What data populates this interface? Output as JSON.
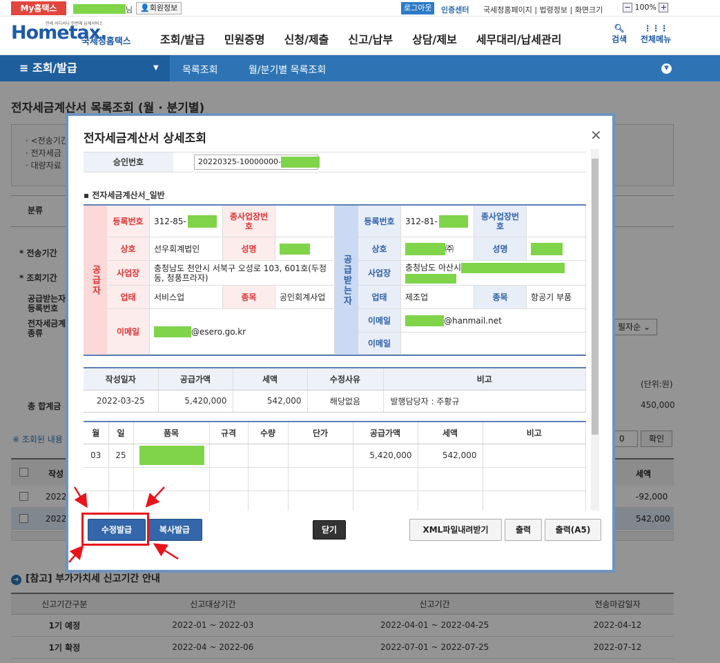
{
  "topbar": {
    "my_hometax": "My홈택스",
    "name_suffix": "님",
    "member_info": "회원정보",
    "logout": "로그아웃",
    "certificate": "인증센터",
    "links": "국세청홈페이지 | 법령정보 | 화면크기",
    "zoom": "100%",
    "zoom_minus": "−",
    "zoom_plus": "+"
  },
  "header": {
    "logo": "Hometax.",
    "logo_sub": "국세청홈택스",
    "logo_tag": "언제 어디서나 한번에 납세서비스",
    "gnb": [
      "조회/발급",
      "민원증명",
      "신청/제출",
      "신고/납부",
      "상담/제보",
      "세무대리/납세관리"
    ],
    "search": "검색",
    "all_menu": "전체메뉴"
  },
  "nav": {
    "main": "조회/발급",
    "crumb1": "목록조회",
    "crumb2": "월/분기별 목록조회"
  },
  "page": {
    "title": "전자세금계산서 목록조회 (월 · 분기별)",
    "info1": "· <전송기간",
    "info2": "· 전자세금",
    "info3": "· 대량자료",
    "cat": "분류",
    "transmit": "* 전송기간",
    "lookup": "* 조회기간",
    "receiver1": "공급받는자",
    "receiver2": "등록번호",
    "type1": "전자세금계",
    "type2": "종류",
    "sort": "필자순",
    "unit": "(단위:원)",
    "total": "총 합계금",
    "total_val": "450,000",
    "note": "※ 조회된 내용",
    "sel0": "0",
    "confirm": "확인",
    "col_written": "작성",
    "col_tax": "세액",
    "row1_date": "2022-",
    "row1_tax": "-92,000",
    "row2_date": "2022-",
    "row2_tax": "542,000"
  },
  "ref": {
    "title": "[참고] 부가가치세 신고기간 안내",
    "headers": [
      "신고기간구분",
      "신고대상기간",
      "신고기간",
      "전송마감일자"
    ],
    "rows": [
      [
        "1기 예정",
        "2022-01 ~ 2022-03",
        "2022-04-01 ~ 2022-04-25",
        "2022-04-12"
      ],
      [
        "1기 확정",
        "2022-04 ~ 2022-06",
        "2022-07-01 ~ 2022-07-25",
        "2022-07-12"
      ]
    ]
  },
  "modal": {
    "title": "전자세금계산서 상세조회",
    "approval_label": "승인번호",
    "approval_value": "20220325-10000000-",
    "section": "전자세금계산서_일반",
    "supplier": {
      "head": "공급자",
      "reg_label": "등록번호",
      "reg_value": "312-85-",
      "sub_label": "종사업장번호",
      "name_label": "상호",
      "name_value": "선우회계법인",
      "rep_label": "성명",
      "addr_label": "사업장",
      "addr_value": "충청남도 천안시 서북구 오성로 103, 601호(두정동, 청풍프라자)",
      "biz_label": "업태",
      "biz_value": "서비스업",
      "item_label": "종목",
      "item_value": "공인회계사업",
      "email_label": "이메일",
      "email_value": "@esero.go.kr"
    },
    "buyer": {
      "head": "공급받는자",
      "reg_label": "등록번호",
      "reg_value": "312-81-",
      "sub_label": "종사업장번호",
      "name_label": "상호",
      "name_suffix": "㈜",
      "rep_label": "성명",
      "addr_label": "사업장",
      "addr_value": "충청남도 아산시",
      "biz_label": "업태",
      "biz_value": "제조업",
      "item_label": "종목",
      "item_value": "항공기 부품",
      "email_label": "이메일",
      "email_value": "@hanmail.net",
      "email2_label": "이메일"
    },
    "summary": {
      "headers": [
        "작성일자",
        "공급가액",
        "세액",
        "수정사유",
        "비고"
      ],
      "row": [
        "2022-03-25",
        "5,420,000",
        "542,000",
        "해당없음",
        "발행담당자 : 주황규"
      ]
    },
    "items": {
      "headers": [
        "월",
        "일",
        "품목",
        "규격",
        "수량",
        "단가",
        "공급가액",
        "세액",
        "비고"
      ],
      "row": [
        "03",
        "25",
        "",
        "",
        "",
        "",
        "5,420,000",
        "542,000",
        ""
      ]
    },
    "buttons": {
      "modify": "수정발급",
      "copy": "복사발급",
      "close": "닫기",
      "xml": "XML파일내려받기",
      "print": "출력",
      "print_a5": "출력(A5)"
    }
  },
  "colors": {
    "accent": "#2e74b5",
    "highlight": "#e8141c",
    "supplier": "#d33333",
    "buyer": "#2e5ea8"
  }
}
